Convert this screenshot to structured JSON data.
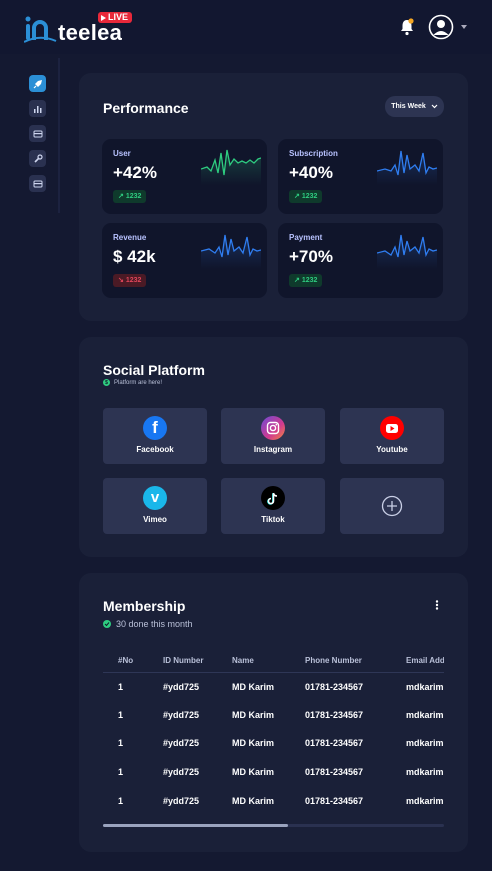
{
  "brand": {
    "name": "teelea",
    "live_badge": "LIVE",
    "logo_icon": "in-logo-icon"
  },
  "topbar": {
    "notification_icon": "bell-icon",
    "avatar_icon": "user-avatar-icon",
    "menu_icon": "caret-down-icon"
  },
  "sidebar": {
    "items": [
      {
        "icon": "rocket-icon",
        "active": true
      },
      {
        "icon": "bar-chart-icon",
        "active": false
      },
      {
        "icon": "card-icon",
        "active": false
      },
      {
        "icon": "wrench-icon",
        "active": false
      },
      {
        "icon": "card-icon",
        "active": false
      }
    ]
  },
  "performance": {
    "title": "Performance",
    "period": "This Week",
    "stats": [
      {
        "label": "User",
        "value": "+42%",
        "badge": "1232",
        "trend": "up",
        "color": "#2ecc80"
      },
      {
        "label": "Subscription",
        "value": "+40%",
        "badge": "1232",
        "trend": "up",
        "color": "#2f7df0"
      },
      {
        "label": "Revenue",
        "value": "$ 42k",
        "badge": "1232",
        "trend": "down",
        "color": "#2f7df0"
      },
      {
        "label": "Payment",
        "value": "+70%",
        "badge": "1232",
        "trend": "up",
        "color": "#2f7df0"
      }
    ]
  },
  "social": {
    "title": "Social Platform",
    "subtitle": "Platform are here!",
    "platforms": [
      {
        "label": "Facebook",
        "icon": "facebook-icon",
        "color": "#1877f2"
      },
      {
        "label": "Instagram",
        "icon": "instagram-icon",
        "color": "#c13584"
      },
      {
        "label": "Youtube",
        "icon": "youtube-icon",
        "color": "#ff0000"
      },
      {
        "label": "Vimeo",
        "icon": "vimeo-icon",
        "color": "#1ab7ea"
      },
      {
        "label": "Tiktok",
        "icon": "tiktok-icon",
        "color": "#000000"
      }
    ],
    "add_icon": "plus-circle-icon"
  },
  "membership": {
    "title": "Membership",
    "subtitle": "30 done this month",
    "columns": [
      "#No",
      "ID Number",
      "Name",
      "Phone Number",
      "Email Add"
    ],
    "rows": [
      [
        "1",
        "#ydd725",
        "MD Karim",
        "01781-234567",
        "mdkarim"
      ],
      [
        "1",
        "#ydd725",
        "MD Karim",
        "01781-234567",
        "mdkarim"
      ],
      [
        "1",
        "#ydd725",
        "MD Karim",
        "01781-234567",
        "mdkarim"
      ],
      [
        "1",
        "#ydd725",
        "MD Karim",
        "01781-234567",
        "mdkarim"
      ],
      [
        "1",
        "#ydd725",
        "MD Karim",
        "01781-234567",
        "mdkarim"
      ]
    ]
  }
}
